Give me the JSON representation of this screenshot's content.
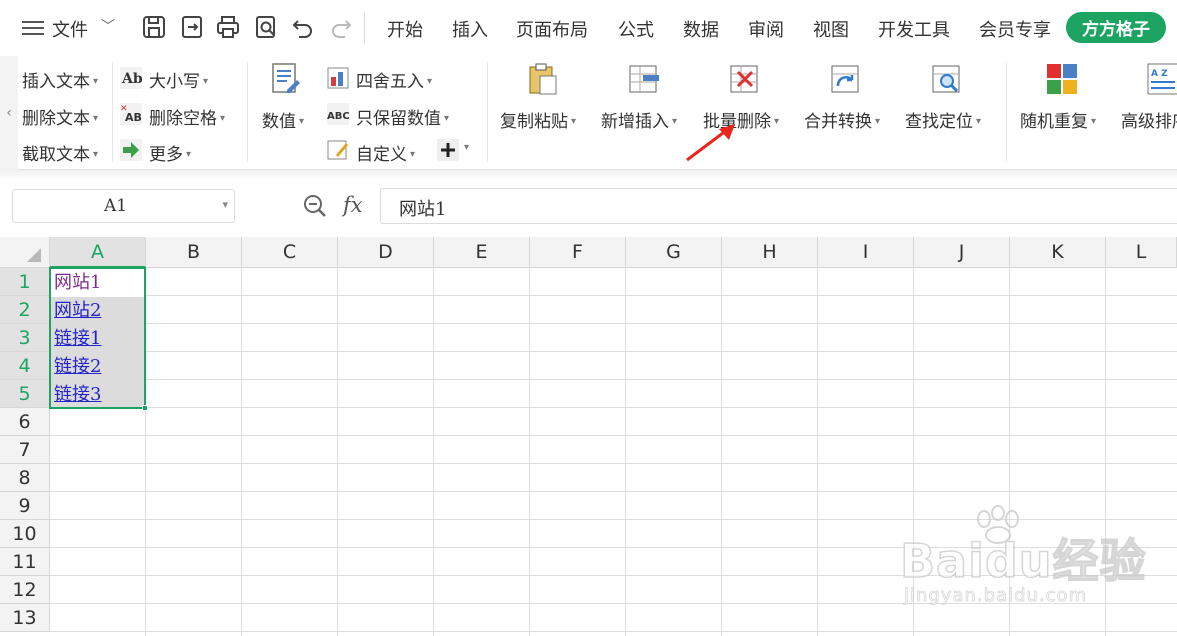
{
  "menubar": {
    "menu_icon": "hamburger-icon",
    "file_label": "文件",
    "quick_access": [
      "save-icon",
      "export-icon",
      "print-icon",
      "print-preview-icon",
      "undo-icon",
      "redo-icon"
    ],
    "tabs": [
      "开始",
      "插入",
      "页面布局",
      "公式",
      "数据",
      "审阅",
      "视图",
      "开发工具",
      "会员专享"
    ],
    "addon_tab": "方方格子",
    "addon_color": "#1da462"
  },
  "ribbon": {
    "text_group": [
      "插入文本",
      "删除文本",
      "截取文本"
    ],
    "case_group": [
      "大小写",
      "删除空格",
      "更多"
    ],
    "number_group": {
      "big_label": "数值",
      "items": [
        "四舍五入",
        "只保留数值",
        "自定义"
      ]
    },
    "big_buttons": [
      "复制粘贴",
      "新增插入",
      "批量删除",
      "合并转换",
      "查找定位",
      "随机重复",
      "高级排序"
    ]
  },
  "formula_bar": {
    "cell_ref": "A1",
    "fx_label": "fx",
    "formula_value": "网站1"
  },
  "sheet": {
    "columns": [
      "A",
      "B",
      "C",
      "D",
      "E",
      "F",
      "G",
      "H",
      "I",
      "J",
      "K",
      "L"
    ],
    "rows": [
      "1",
      "2",
      "3",
      "4",
      "5",
      "6",
      "7",
      "8",
      "9",
      "10",
      "11",
      "12",
      "13"
    ],
    "cells_A": [
      "网站1",
      "网站2",
      "链接1",
      "链接2",
      "链接3"
    ],
    "selection_color": "#1da462",
    "hyperlink_color": "#2424cc"
  },
  "watermark": {
    "brand": "Baidu经验",
    "url": "jingyan.baidu.com"
  }
}
